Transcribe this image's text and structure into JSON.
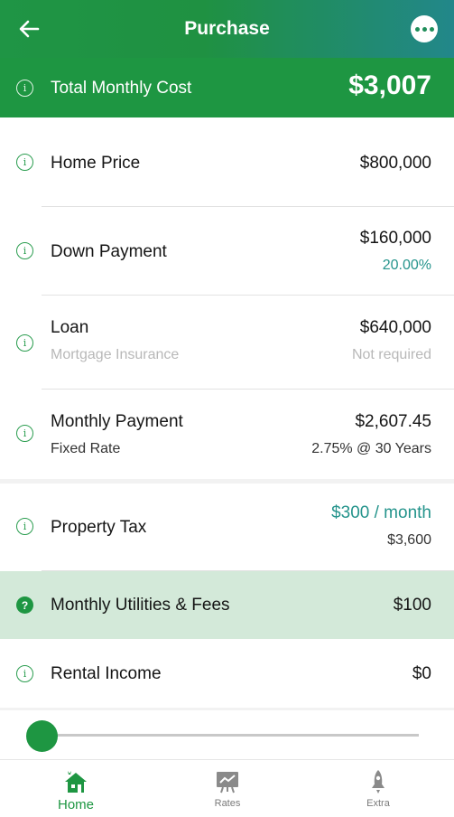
{
  "header": {
    "title": "Purchase",
    "back_icon": "arrow-left-icon",
    "menu_icon": "more-horizontal-icon"
  },
  "total": {
    "label": "Total Monthly Cost",
    "value": "$3,007"
  },
  "rows": {
    "home_price": {
      "label": "Home Price",
      "value": "$800,000"
    },
    "down_payment": {
      "label": "Down Payment",
      "value": "$160,000",
      "percent": "20.00%"
    },
    "loan": {
      "label": "Loan",
      "value": "$640,000",
      "sub_label": "Mortgage Insurance",
      "sub_value": "Not required"
    },
    "monthly_payment": {
      "label": "Monthly Payment",
      "value": "$2,607.45",
      "sub_label": "Fixed Rate",
      "sub_value": "2.75% @ 30 Years"
    },
    "property_tax": {
      "label": "Property Tax",
      "value": "$300 / month",
      "sub_value": "$3,600"
    },
    "utilities": {
      "label": "Monthly Utilities & Fees",
      "value": "$100"
    },
    "rental": {
      "label": "Rental Income",
      "value": "$0"
    }
  },
  "slider": {
    "value_fraction": 0.0
  },
  "nav": {
    "home": "Home",
    "rates": "Rates",
    "extra": "Extra"
  },
  "colors": {
    "primary": "#1e9642",
    "teal": "#25948c",
    "highlight": "#d3e9d9"
  }
}
